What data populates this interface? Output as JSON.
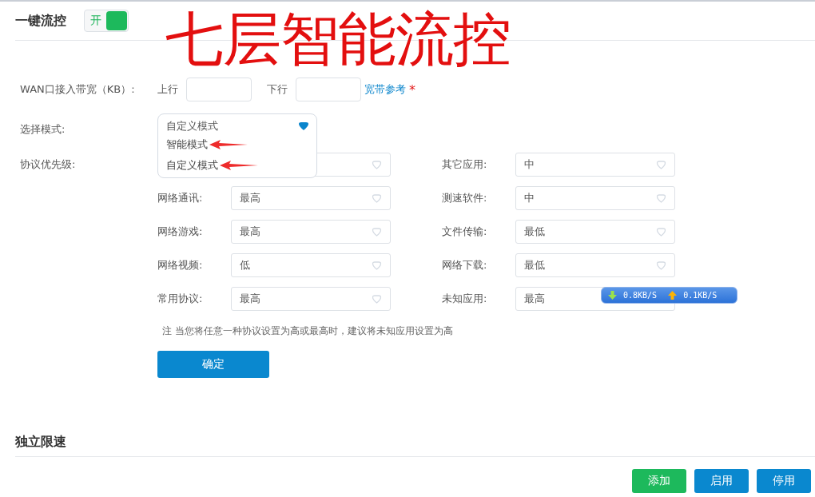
{
  "section1": {
    "title": "一键流控",
    "switch": {
      "label": "开",
      "on": true
    }
  },
  "overlay_title": "七层智能流控",
  "wan": {
    "label": "WAN口接入带宽（KB）:",
    "up_label": "上行",
    "down_label": "下行",
    "link": "宽带参考",
    "required": "*"
  },
  "mode": {
    "label": "选择模式:",
    "value": "自定义模式",
    "options": [
      {
        "label": "智能模式",
        "arrow": true
      },
      {
        "label": "自定义模式",
        "arrow": true
      }
    ]
  },
  "priority": {
    "label": "协议优先级:",
    "left": [
      {
        "label": "网络通讯:",
        "value": "最高"
      },
      {
        "label": "网络游戏:",
        "value": "最高"
      },
      {
        "label": "网络视频:",
        "value": "低"
      },
      {
        "label": "常用协议:",
        "value": "最高"
      }
    ],
    "right": [
      {
        "label": "其它应用:",
        "value": "中"
      },
      {
        "label": "测速软件:",
        "value": "中"
      },
      {
        "label": "文件传输:",
        "value": "最低"
      },
      {
        "label": "网络下载:",
        "value": "最低"
      },
      {
        "label": "未知应用:",
        "value": "最高"
      }
    ]
  },
  "note": "注 当您将任意一种协议设置为高或最高时，建议将未知应用设置为高",
  "confirm": "确定",
  "speed": {
    "down": "0.8KB/S",
    "up": "0.1KB/S"
  },
  "section2": {
    "title": "独立限速"
  },
  "buttons": [
    {
      "label": "添加",
      "kind": "add"
    },
    {
      "label": "启用",
      "kind": "primary"
    },
    {
      "label": "停用",
      "kind": "primary"
    }
  ]
}
